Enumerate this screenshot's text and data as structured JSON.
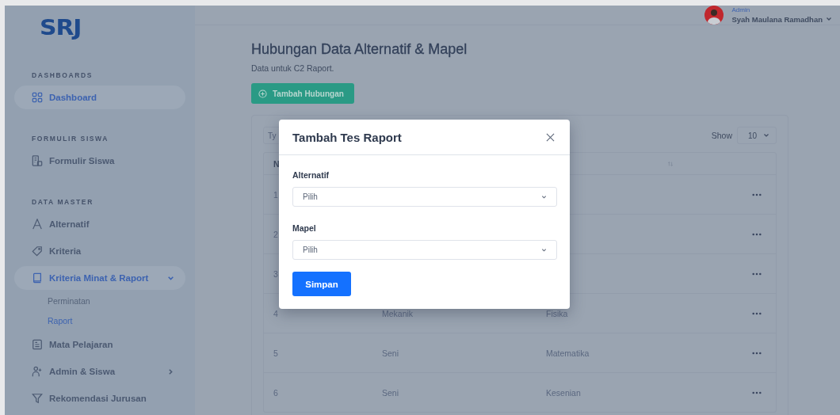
{
  "sidebar": {
    "logo": "SRJ",
    "sections": [
      {
        "heading": "DASHBOARDS",
        "items": [
          {
            "label": "Dashboard",
            "selected": true
          }
        ]
      },
      {
        "heading": "FORMULIR SISWA",
        "items": [
          {
            "label": "Formulir Siswa",
            "selected": false
          }
        ]
      },
      {
        "heading": "DATA MASTER",
        "items": [
          {
            "label": "Alternatif",
            "selected": false
          },
          {
            "label": "Kriteria",
            "selected": false
          },
          {
            "label": "Kriteria Minat & Raport",
            "selected": true,
            "expanded": true,
            "children": [
              {
                "label": "Perminatan",
                "selected": false
              },
              {
                "label": "Raport",
                "selected": true
              }
            ]
          },
          {
            "label": "Mata Pelajaran",
            "selected": false
          },
          {
            "label": "Admin & Siswa",
            "selected": false,
            "expanded": false
          },
          {
            "label": "Rekomendasi Jurusan",
            "selected": false
          }
        ]
      }
    ]
  },
  "header": {
    "user": {
      "role": "Admin",
      "name": "Syah Maulana Ramadhan"
    }
  },
  "page": {
    "title": "Hubungan Data Alternatif & Mapel",
    "subtitle": "Data untuk C2 Raport.",
    "add_button": "Tambah Hubungan"
  },
  "table": {
    "search_placeholder": "Ty",
    "show_label": "Show",
    "page_size": "10",
    "columns": [
      "N"
    ],
    "rows": [
      {
        "cells": [
          "1"
        ]
      },
      {
        "cells": [
          "2"
        ]
      },
      {
        "cells": [
          "3"
        ]
      },
      {
        "cells": [
          "4",
          "Mekanik",
          "Fisika"
        ]
      },
      {
        "cells": [
          "5",
          "Seni",
          "Matematika"
        ]
      },
      {
        "cells": [
          "6",
          "Seni",
          "Kesenian"
        ]
      }
    ]
  },
  "modal": {
    "title": "Tambah Tes Raport",
    "fields": [
      {
        "label": "Alternatif",
        "value": "Pilih"
      },
      {
        "label": "Mapel",
        "value": "Pilih"
      }
    ],
    "submit": "Simpan"
  }
}
